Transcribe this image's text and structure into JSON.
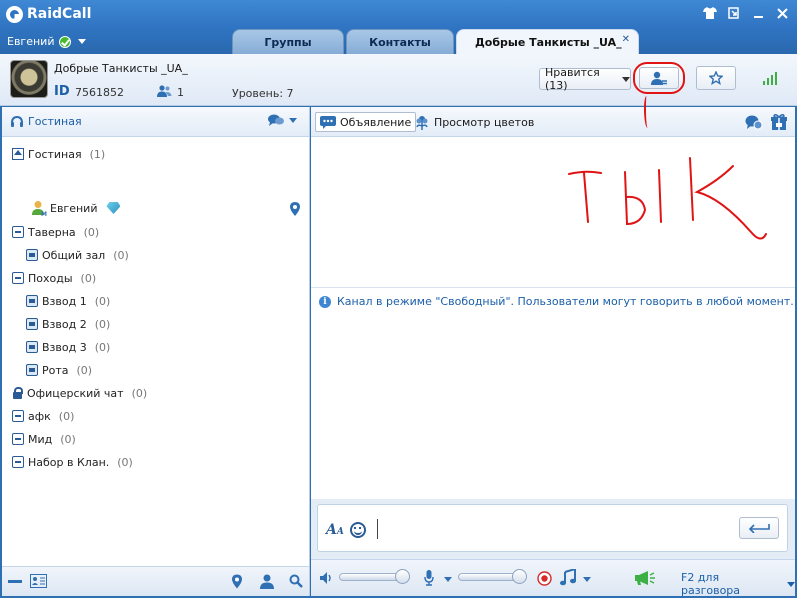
{
  "app": {
    "name": "RaidCall"
  },
  "window": {
    "controls": [
      "skin-icon",
      "minimize-to-tray-icon",
      "minimize-icon",
      "close-icon"
    ]
  },
  "user": {
    "name": "Евгений"
  },
  "tabs": [
    {
      "label": "Группы",
      "active": false
    },
    {
      "label": "Контакты",
      "active": false
    },
    {
      "label": "Добрые Танкисты _UA_",
      "active": true
    }
  ],
  "channel": {
    "name": "Добрые Танкисты _UA_",
    "id_label": "ID",
    "id": "7561852",
    "members": "1",
    "level": "Уровень: 7",
    "like_label": "Нравится (13)"
  },
  "left": {
    "lobby_label": "Гостиная",
    "tree": [
      {
        "label": "Гостиная",
        "count": "(1)",
        "icon": "home-icon",
        "indent": 0
      },
      {
        "label": "Евгений",
        "count": "",
        "icon": "user-icon",
        "indent": 1,
        "user": true
      },
      {
        "label": "Таверна",
        "count": "(0)",
        "icon": "collapse-icon",
        "indent": 0
      },
      {
        "label": "Общий зал",
        "count": "(0)",
        "icon": "channel-icon",
        "indent": 1
      },
      {
        "label": "Походы",
        "count": "(0)",
        "icon": "collapse-icon",
        "indent": 0
      },
      {
        "label": "Взвод 1",
        "count": "(0)",
        "icon": "channel-icon",
        "indent": 1
      },
      {
        "label": "Взвод 2",
        "count": "(0)",
        "icon": "channel-icon",
        "indent": 1
      },
      {
        "label": "Взвод 3",
        "count": "(0)",
        "icon": "channel-icon",
        "indent": 1
      },
      {
        "label": "Рота",
        "count": "(0)",
        "icon": "channel-icon",
        "indent": 1
      },
      {
        "label": "Офицерский чат",
        "count": "(0)",
        "icon": "lock-icon",
        "indent": 0
      },
      {
        "label": "афк",
        "count": "(0)",
        "icon": "collapse-icon",
        "indent": 0
      },
      {
        "label": "Мид",
        "count": "(0)",
        "icon": "collapse-icon",
        "indent": 0
      },
      {
        "label": "Набор в Клан.",
        "count": "(0)",
        "icon": "collapse-icon",
        "indent": 0
      }
    ]
  },
  "right": {
    "announce_label": "Объявление",
    "flowers_label": "Просмотр цветов",
    "annotation_text": "ТЫК",
    "system_message": "Канал в режиме \"Свободный\". Пользователи могут говорить в любой момент.",
    "talk_mode": "F2 для разговора",
    "volume": 1.0,
    "mic_volume": 1.0
  },
  "colors": {
    "accent": "#2f74c2",
    "link": "#1b5fa8",
    "annotation": "#e01414",
    "online": "#46b92d"
  }
}
